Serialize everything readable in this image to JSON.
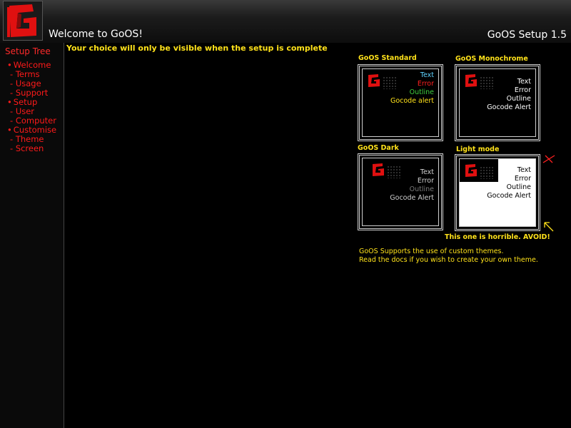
{
  "header": {
    "welcome": "Welcome to GoOS!",
    "version": "GoOS Setup 1.5"
  },
  "sidebar": {
    "title": "Setup Tree",
    "items": [
      {
        "label": "Welcome",
        "level": 1
      },
      {
        "label": "Terms",
        "level": 2
      },
      {
        "label": "Usage",
        "level": 2
      },
      {
        "label": "Support",
        "level": 2
      },
      {
        "label": "Setup",
        "level": 1
      },
      {
        "label": "User",
        "level": 2
      },
      {
        "label": "Computer",
        "level": 2
      },
      {
        "label": "Customise",
        "level": 1
      },
      {
        "label": "Theme",
        "level": 2
      },
      {
        "label": "Screen",
        "level": 2
      }
    ]
  },
  "notice": "Your choice will only be visible when the setup is complete",
  "themes": [
    {
      "name": "GoOS Standard",
      "lines": [
        "Text",
        "Error",
        "Outline",
        "Gocode alert"
      ],
      "colors": {
        "bg": "#000000",
        "text": "#5fd3ff",
        "error": "#ff2020",
        "outline": "#3fcf3f",
        "alert": "#ffe21a"
      }
    },
    {
      "name": "GoOS Monochrome",
      "lines": [
        "Text",
        "Error",
        "Outline",
        "Gocode Alert"
      ],
      "colors": {
        "bg": "#000000",
        "text": "#ffffff",
        "error": "#ffffff",
        "outline": "#ffffff",
        "alert": "#ffffff"
      }
    },
    {
      "name": "GoOS Dark",
      "lines": [
        "Text",
        "Error",
        "Outline",
        "Gocode Alert"
      ],
      "colors": {
        "bg": "#000000",
        "text": "#cfcfcf",
        "error": "#cfcfcf",
        "outline": "#7a7a7a",
        "alert": "#cfcfcf"
      }
    },
    {
      "name": "Light mode",
      "lines": [
        "Text",
        "Error",
        "Outline",
        "Gocode Alert"
      ],
      "colors": {
        "bg": "#ffffff",
        "text": "#000000",
        "error": "#000000",
        "outline": "#000000",
        "alert": "#000000"
      }
    }
  ],
  "warning": "This one is horrible. AVOID!",
  "info_lines": [
    "GoOS Supports the use of custom themes.",
    "Read the docs if you wish to create your own theme."
  ],
  "colors": {
    "accent_red": "#ff1a1a",
    "accent_yellow": "#ffe21a"
  }
}
